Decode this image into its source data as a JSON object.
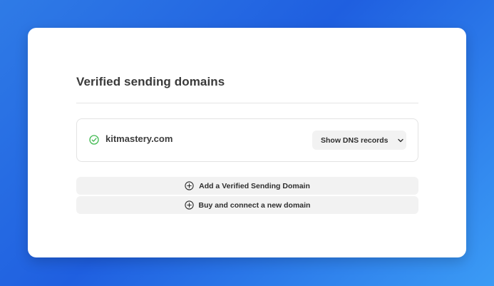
{
  "section": {
    "title": "Verified sending domains"
  },
  "domains": [
    {
      "name": "kitmastery.com",
      "status_icon": "check-circle-icon",
      "status_color": "#3fb950",
      "dns_button_label": "Show DNS records",
      "dns_button_icon": "chevron-down-icon"
    }
  ],
  "actions": {
    "add_domain_label": "Add a Verified Sending Domain",
    "buy_domain_label": "Buy and connect a new domain",
    "icon": "plus-circle-icon"
  },
  "colors": {
    "background_gradient_start": "#2f7be6",
    "background_gradient_end": "#3b9bf5",
    "card": "#ffffff",
    "button_bg": "#f2f2f2",
    "verified_green": "#3fb950"
  }
}
